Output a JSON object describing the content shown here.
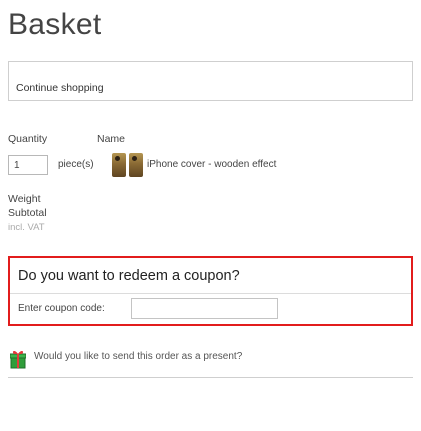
{
  "page": {
    "title": "Basket"
  },
  "navigation": {
    "continue_label": "Continue shopping"
  },
  "table": {
    "headers": {
      "quantity": "Quantity",
      "name": "Name"
    },
    "items": [
      {
        "quantity": "1",
        "unit": "piece(s)",
        "product_name": "iPhone cover - wooden effect",
        "image_icons": [
          "phone-cover-thumbnail-icon",
          "phone-cover-thumbnail-icon"
        ]
      }
    ]
  },
  "summary": {
    "weight_label": "Weight",
    "subtotal_label": "Subtotal",
    "vat_note": "incl. VAT"
  },
  "coupon": {
    "title": "Do you want to redeem a coupon?",
    "code_label": "Enter coupon code:",
    "code_value": "",
    "border_color": "#e21c1c"
  },
  "gift": {
    "icon": "gift-icon",
    "text": "Would you like to send this order as a present?"
  }
}
